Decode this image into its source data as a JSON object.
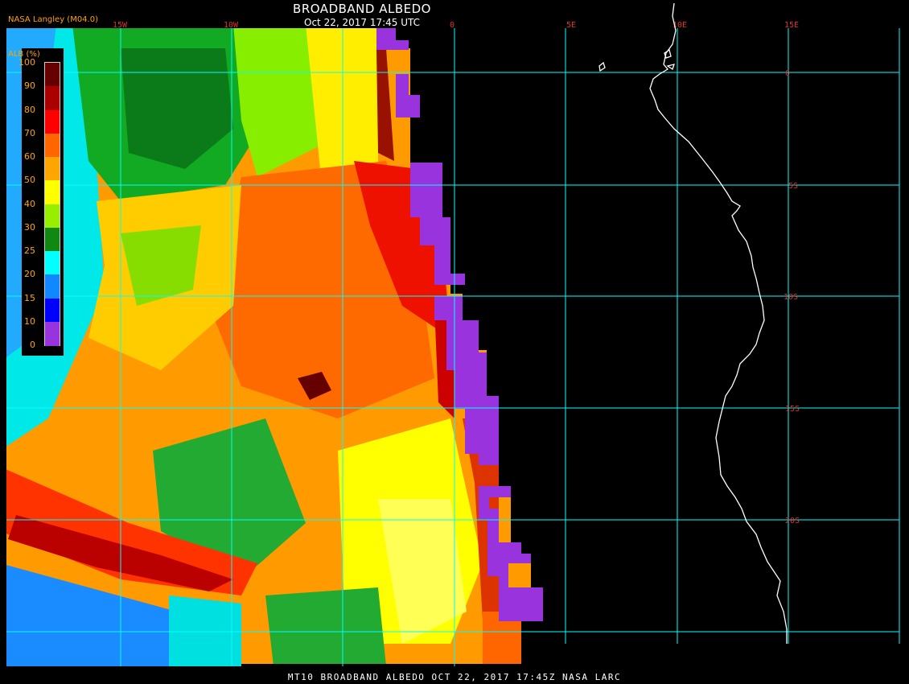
{
  "header": {
    "title": "BROADBAND ALBEDO",
    "date": "Oct 22, 2017 17:45 UTC",
    "producer": "NASA Langley (M04.0)"
  },
  "legend": {
    "title": "ALB (%)",
    "labels": [
      "100",
      "90",
      "80",
      "70",
      "60",
      "50",
      "40",
      "30",
      "25",
      "20",
      "15",
      "10",
      "0"
    ],
    "colors": [
      "#660000",
      "#aa0000",
      "#ff0000",
      "#ff6600",
      "#ffa500",
      "#ffff00",
      "#99ee00",
      "#118811",
      "#00ffff",
      "#1188ff",
      "#0000ff",
      "#9933dd"
    ]
  },
  "grid": {
    "lon_labels": [
      "15W",
      "10W",
      "0",
      "5E",
      "10E",
      "15E"
    ],
    "lat_labels": [
      "0",
      "5S",
      "10S",
      "15S",
      "20S"
    ]
  },
  "footer": {
    "text": "MT10  BROADBAND ALBEDO   OCT 22, 2017 17:45Z   NASA LARC"
  },
  "colors": {
    "grid": "#00ffff",
    "grid_label": "#e03030",
    "legend_text": "#ffa500",
    "no_data": "#9933dd"
  }
}
